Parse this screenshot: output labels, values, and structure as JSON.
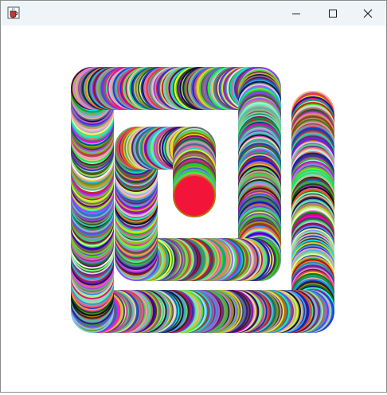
{
  "window": {
    "title": "",
    "icon": "java-cup-icon",
    "controls": {
      "minimize": "minimize-icon",
      "maximize": "maximize-icon",
      "close": "close-icon"
    }
  },
  "canvas": {
    "description": "",
    "shape": "square-spiral-of-overlapping-random-colored-circles",
    "background": "#ffffff"
  }
}
